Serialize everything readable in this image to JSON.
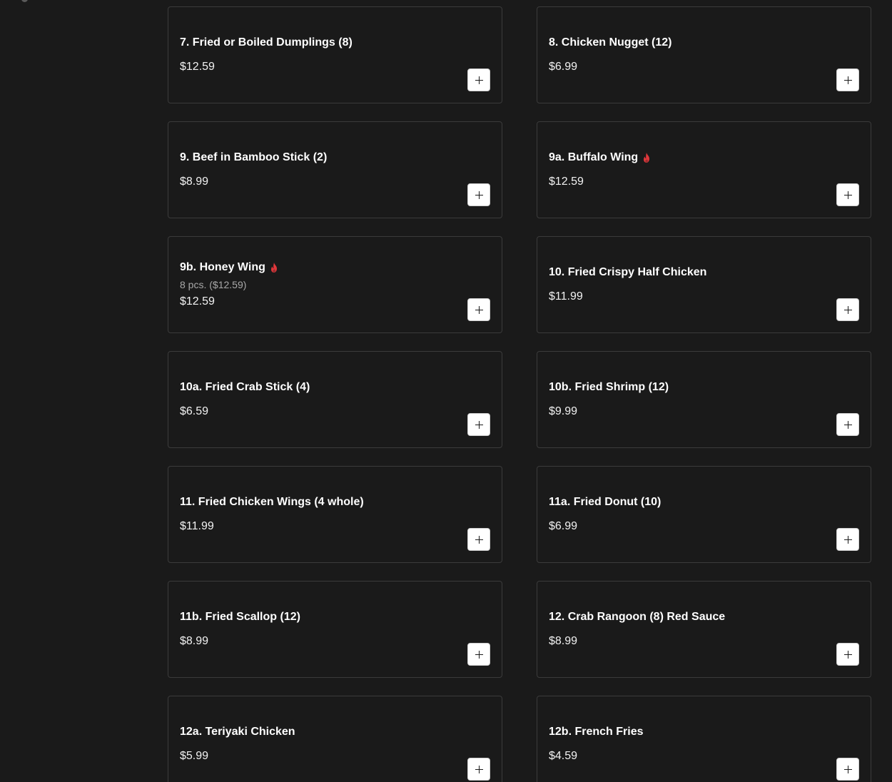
{
  "menu": {
    "items": [
      {
        "name": "",
        "desc": "",
        "price": "",
        "spicy": false
      },
      {
        "name": "",
        "desc": "",
        "price": "",
        "spicy": false
      },
      {
        "name": "7. Fried or Boiled Dumplings (8)",
        "desc": "",
        "price": "$12.59",
        "spicy": false
      },
      {
        "name": "8. Chicken Nugget (12)",
        "desc": "",
        "price": "$6.99",
        "spicy": false
      },
      {
        "name": "9. Beef in Bamboo Stick (2)",
        "desc": "",
        "price": "$8.99",
        "spicy": false
      },
      {
        "name": "9a. Buffalo Wing",
        "desc": "",
        "price": "$12.59",
        "spicy": true
      },
      {
        "name": "9b. Honey Wing",
        "desc": "8 pcs. ($12.59)",
        "price": "$12.59",
        "spicy": true
      },
      {
        "name": "10. Fried Crispy Half Chicken",
        "desc": "",
        "price": "$11.99",
        "spicy": false
      },
      {
        "name": "10a. Fried Crab Stick (4)",
        "desc": "",
        "price": "$6.59",
        "spicy": false
      },
      {
        "name": "10b. Fried Shrimp (12)",
        "desc": "",
        "price": "$9.99",
        "spicy": false
      },
      {
        "name": "11. Fried Chicken Wings (4 whole)",
        "desc": "",
        "price": "$11.99",
        "spicy": false
      },
      {
        "name": "11a. Fried Donut (10)",
        "desc": "",
        "price": "$6.99",
        "spicy": false
      },
      {
        "name": "11b. Fried Scallop (12)",
        "desc": "",
        "price": "$8.99",
        "spicy": false
      },
      {
        "name": "12. Crab Rangoon (8) Red Sauce",
        "desc": "",
        "price": "$8.99",
        "spicy": false
      },
      {
        "name": "12a. Teriyaki Chicken",
        "desc": "",
        "price": "$5.99",
        "spicy": false
      },
      {
        "name": "12b. French Fries",
        "desc": "",
        "price": "$4.59",
        "spicy": false
      }
    ]
  },
  "icons": {
    "spicy": "flame-icon",
    "add": "plus-icon"
  },
  "colors": {
    "background": "#1a1a1a",
    "card_border": "#3b3b3b",
    "spicy": "#e0373b",
    "add_button_bg": "#ffffff"
  }
}
